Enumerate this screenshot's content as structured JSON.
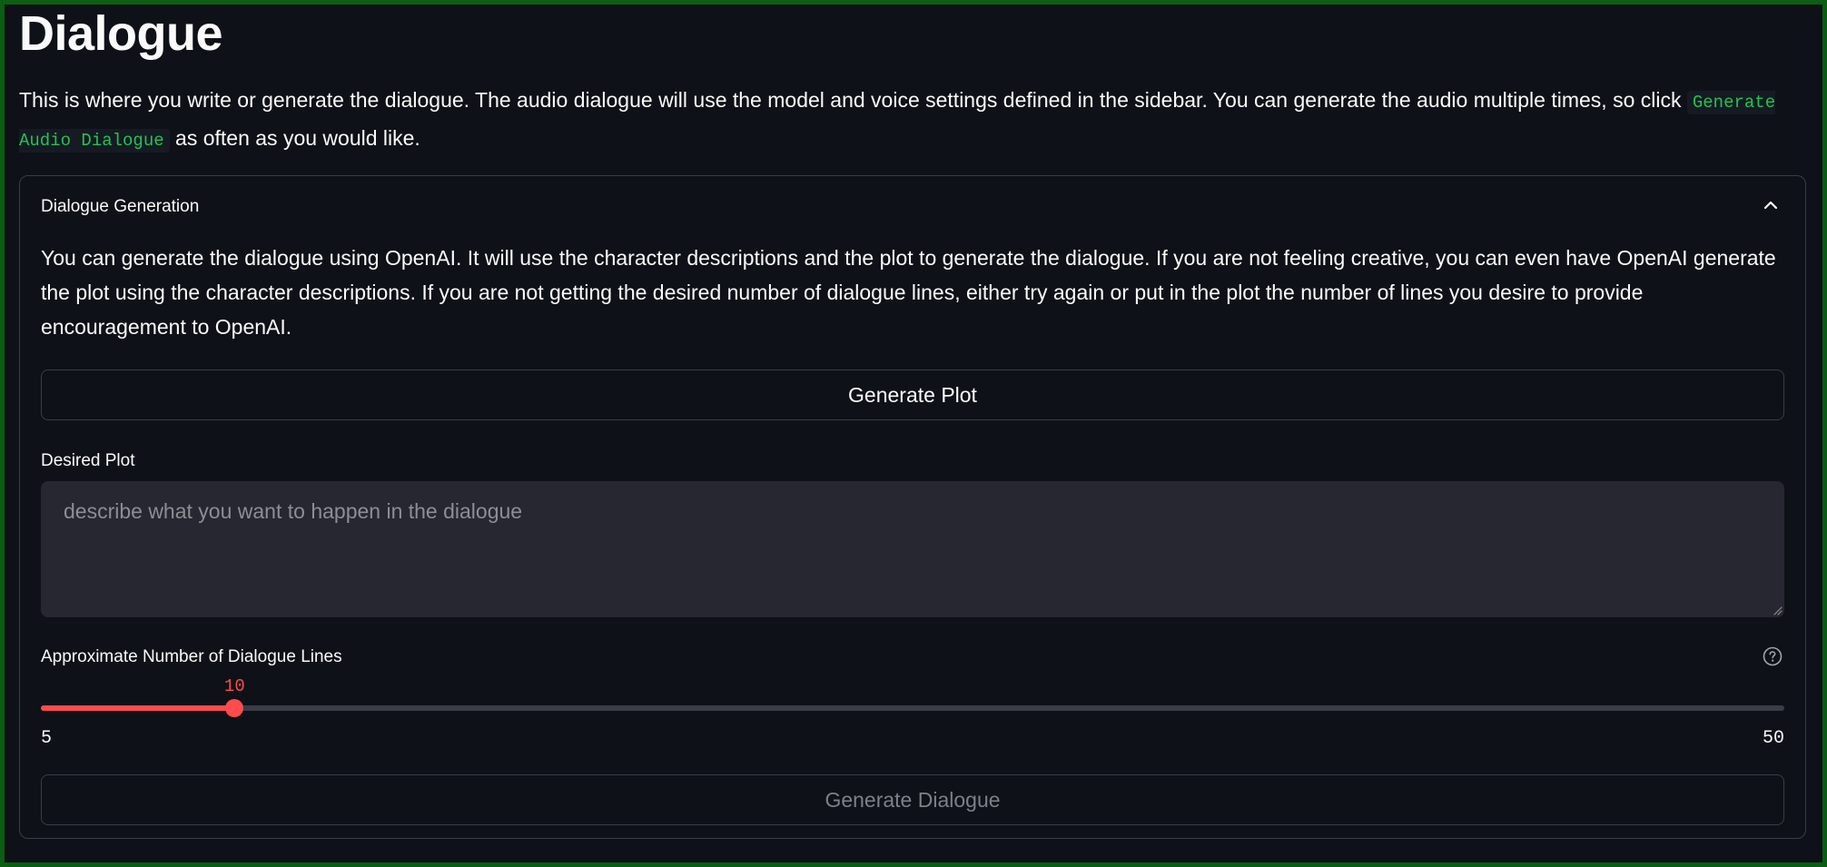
{
  "page": {
    "title": "Dialogue",
    "intro_before_code": "This is where you write or generate the dialogue. The audio dialogue will use the model and voice settings defined in the sidebar. You can generate the audio multiple times, so click ",
    "intro_code": "Generate Audio Dialogue",
    "intro_after_code": " as often as you would like."
  },
  "expander": {
    "title": "Dialogue Generation",
    "expanded": true,
    "chevron_icon": "chevron-up-icon",
    "description": "You can generate the dialogue using OpenAI. It will use the character descriptions and the plot to generate the dialogue. If you are not feeling creative, you can even have OpenAI generate the plot using the character descriptions. If you are not getting the desired number of dialogue lines, either try again or put in the plot the number of lines you desire to provide encouragement to OpenAI."
  },
  "generate_plot_button": {
    "label": "Generate Plot"
  },
  "plot_input": {
    "label": "Desired Plot",
    "value": "",
    "placeholder": "describe what you want to happen in the dialogue"
  },
  "lines_slider": {
    "label": "Approximate Number of Dialogue Lines",
    "value": "10",
    "min": "5",
    "max": "50",
    "help_icon": "question-circle-icon"
  },
  "generate_dialogue_button": {
    "label": "Generate Dialogue",
    "disabled": true
  },
  "colors": {
    "background": "#0e1117",
    "accent": "#ff4b4b",
    "code_text": "#21c354",
    "border": "#3a3d46",
    "input_background": "#262730",
    "frame": "#0b5e12"
  }
}
